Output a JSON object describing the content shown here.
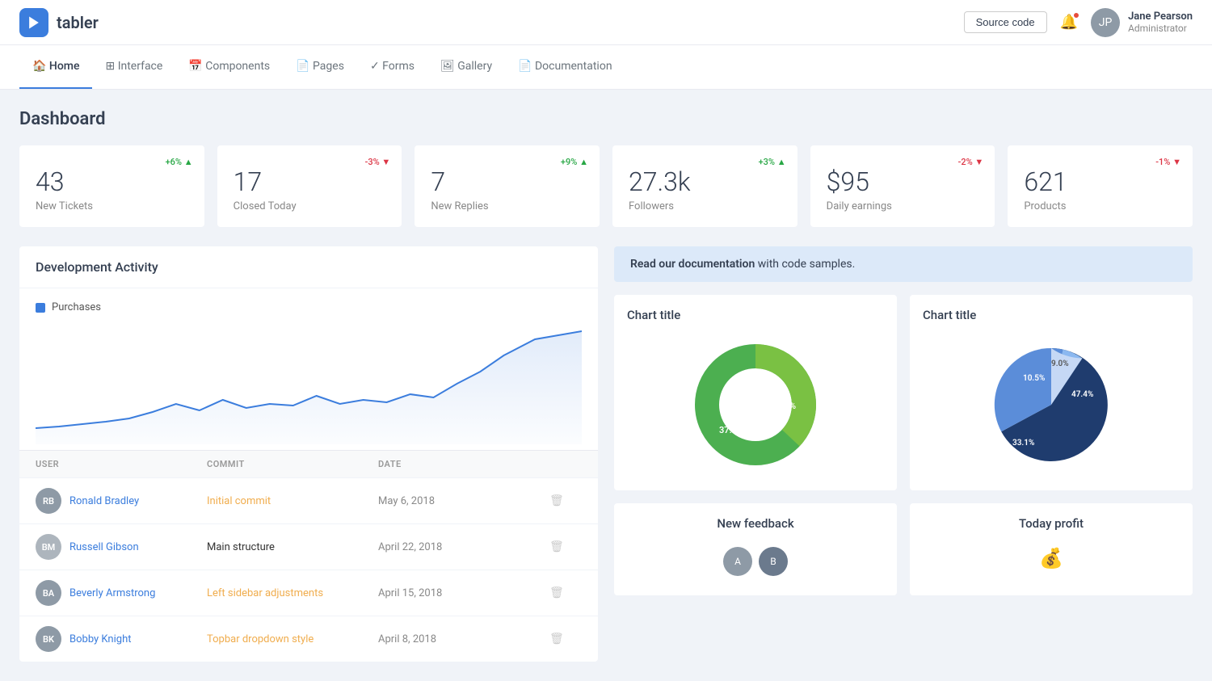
{
  "header": {
    "logo_text": "tabler",
    "source_code_label": "Source code",
    "notification_icon": "bell",
    "user": {
      "name": "Jane Pearson",
      "role": "Administrator",
      "initials": "JP"
    }
  },
  "nav": {
    "items": [
      {
        "label": "Home",
        "icon": "🏠",
        "active": true
      },
      {
        "label": "Interface",
        "icon": "⊞",
        "active": false
      },
      {
        "label": "Components",
        "icon": "📅",
        "active": false
      },
      {
        "label": "Pages",
        "icon": "📄",
        "active": false
      },
      {
        "label": "Forms",
        "icon": "✓",
        "active": false
      },
      {
        "label": "Gallery",
        "icon": "🖼",
        "active": false
      },
      {
        "label": "Documentation",
        "icon": "📄",
        "active": false
      }
    ]
  },
  "page": {
    "title": "Dashboard"
  },
  "stats": [
    {
      "value": "43",
      "label": "New Tickets",
      "badge": "+6%",
      "positive": true
    },
    {
      "value": "17",
      "label": "Closed Today",
      "badge": "-3%",
      "positive": false
    },
    {
      "value": "7",
      "label": "New Replies",
      "badge": "+9%",
      "positive": true
    },
    {
      "value": "27.3k",
      "label": "Followers",
      "badge": "+3%",
      "positive": true
    },
    {
      "value": "$95",
      "label": "Daily earnings",
      "badge": "-2%",
      "positive": false
    },
    {
      "value": "621",
      "label": "Products",
      "badge": "-1%",
      "positive": false
    }
  ],
  "dev_activity": {
    "title": "Development Activity",
    "legend": "Purchases",
    "table": {
      "columns": [
        "USER",
        "COMMIT",
        "DATE"
      ],
      "rows": [
        {
          "name": "Ronald Bradley",
          "initials": "RB",
          "color": "#8e9aa6",
          "has_photo": true,
          "commit": "Initial commit",
          "commit_color": "#f0ad4e",
          "date": "May 6, 2018"
        },
        {
          "name": "Russell Gibson",
          "initials": "BM",
          "color": "#adb5bd",
          "has_photo": false,
          "commit": "Main structure",
          "commit_color": "#333",
          "date": "April 22, 2018"
        },
        {
          "name": "Beverly Armstrong",
          "initials": "BA",
          "color": "#8e9aa6",
          "has_photo": true,
          "commit": "Left sidebar adjustments",
          "commit_color": "#f0ad4e",
          "date": "April 15, 2018"
        },
        {
          "name": "Bobby Knight",
          "initials": "BK",
          "color": "#8e9aa6",
          "has_photo": true,
          "commit": "Topbar dropdown style",
          "commit_color": "#f0ad4e",
          "date": "April 8, 2018"
        }
      ]
    }
  },
  "doc_banner": {
    "text_bold": "Read our documentation",
    "text_rest": " with code samples."
  },
  "chart1": {
    "title": "Chart title",
    "segments": [
      {
        "label": "37.0%",
        "value": 37,
        "color": "#7ac143"
      },
      {
        "label": "63.0%",
        "value": 63,
        "color": "#4CAF50"
      }
    ]
  },
  "chart2": {
    "title": "Chart title",
    "segments": [
      {
        "label": "47.4%",
        "value": 47.4,
        "color": "#1f3c6e"
      },
      {
        "label": "33.1%",
        "value": 33.1,
        "color": "#5b8dd9"
      },
      {
        "label": "10.5%",
        "value": 10.5,
        "color": "#8bb8f0"
      },
      {
        "label": "9.0%",
        "value": 9.0,
        "color": "#c5d8f5"
      }
    ]
  },
  "bottom_cards": [
    {
      "title": "New feedback"
    },
    {
      "title": "Today profit"
    }
  ]
}
